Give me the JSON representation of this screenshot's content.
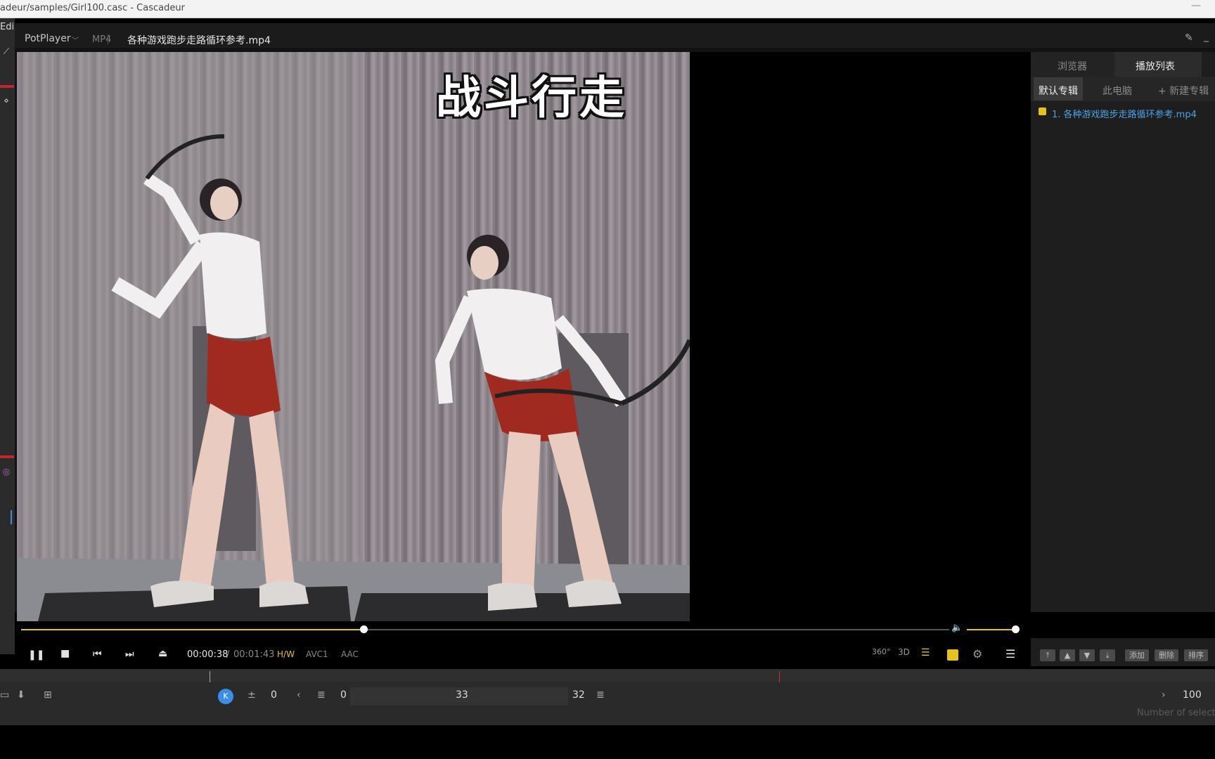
{
  "window": {
    "title": "adeur/samples/Girl100.casc - Cascadeur",
    "minimize": "—"
  },
  "cascadeur": {
    "menu_label": "Edi",
    "timeline": {
      "start": "0",
      "frame": "0",
      "center_value": "33",
      "end": "32",
      "zoom": "100",
      "status_text": "Number of select"
    }
  },
  "player": {
    "app_name": "PotPlayer",
    "format": "MP4",
    "file_name": "各种游戏跑步走路循环参考.mp4",
    "subtitle": "战斗行走",
    "time_current": "00:00:38",
    "time_separator": "/",
    "time_total": "00:01:43",
    "progress_fraction": 0.37,
    "volume_fraction": 1.0,
    "badges": {
      "hw": "H/W",
      "video_codec": "AVC1",
      "audio_codec": "AAC"
    },
    "right_icons": {
      "vr": "360°",
      "three_d": "3D"
    }
  },
  "playlist": {
    "tabs": [
      {
        "label": "浏览器"
      },
      {
        "label": "播放列表"
      }
    ],
    "subtabs": [
      {
        "label": "默认专辑"
      },
      {
        "label": "此电脑"
      },
      {
        "label": "+ 新建专辑"
      }
    ],
    "items": [
      {
        "label": "1. 各种游戏跑步走路循环参考.mp4"
      }
    ],
    "buttons": {
      "add": "添加",
      "delete": "删除",
      "sort": "排序"
    }
  },
  "colors": {
    "accent": "#e8c21a",
    "link": "#4aa3e8",
    "cascadeur_red": "#c0282c"
  }
}
